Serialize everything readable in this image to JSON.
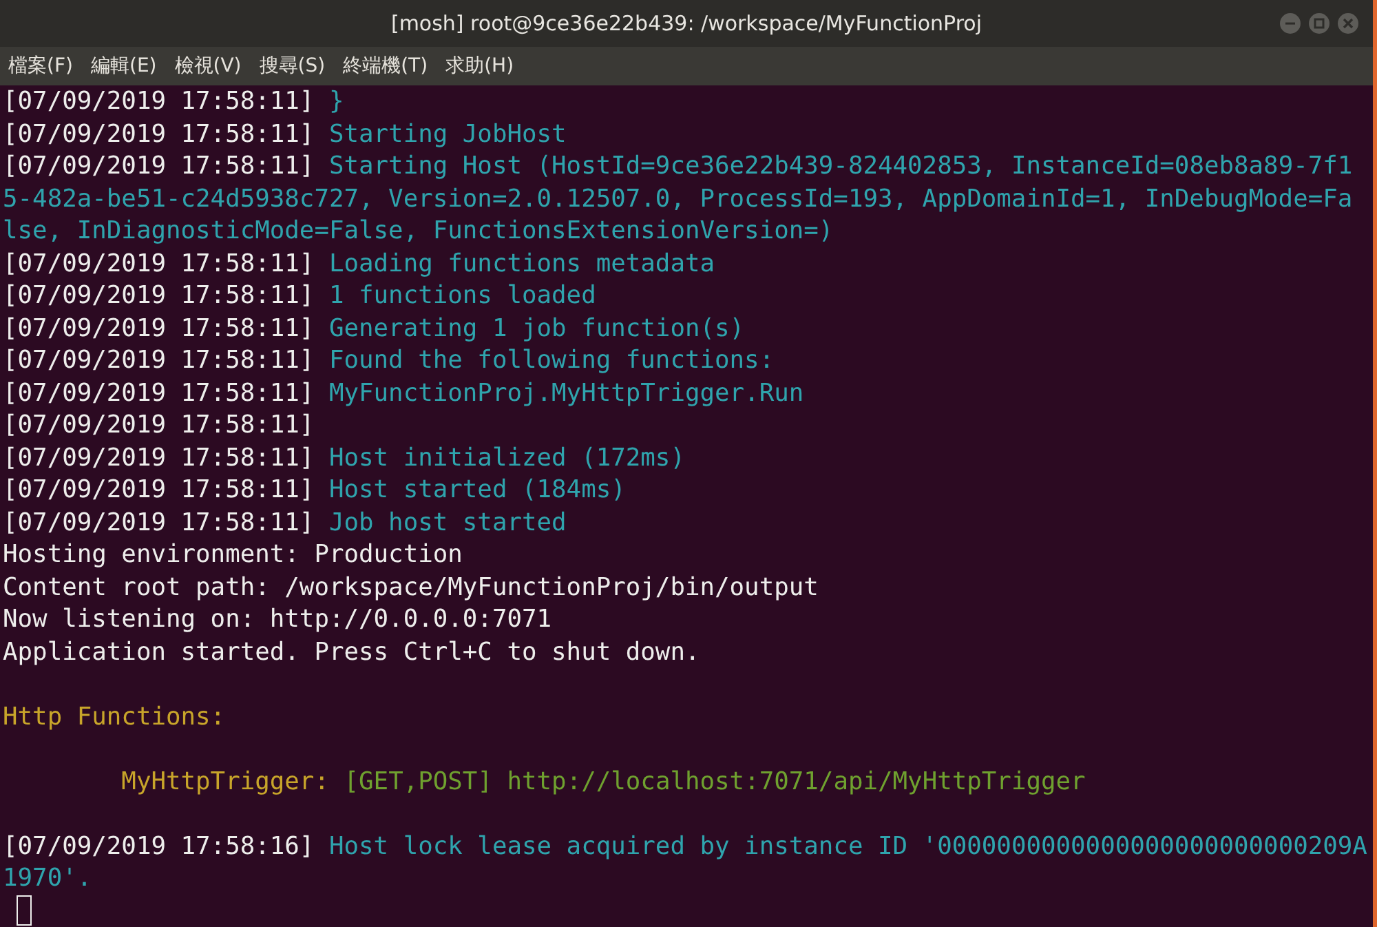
{
  "window": {
    "title": "[mosh] root@9ce36e22b439: /workspace/MyFunctionProj"
  },
  "menu": [
    {
      "label": "檔案(F)"
    },
    {
      "label": "編輯(E)"
    },
    {
      "label": "檢視(V)"
    },
    {
      "label": "搜尋(S)"
    },
    {
      "label": "終端機(T)"
    },
    {
      "label": "求助(H)"
    }
  ],
  "terminal": {
    "lines": [
      {
        "kind": "text",
        "segments": [
          {
            "kind": "plain",
            "text": "[07/09/2019 17:58:11] "
          },
          {
            "kind": "info",
            "text": "}"
          }
        ]
      },
      {
        "kind": "text",
        "segments": [
          {
            "kind": "plain",
            "text": "[07/09/2019 17:58:11] "
          },
          {
            "kind": "info",
            "text": "Starting JobHost"
          }
        ]
      },
      {
        "kind": "text",
        "segments": [
          {
            "kind": "plain",
            "text": "[07/09/2019 17:58:11] "
          },
          {
            "kind": "info",
            "text": "Starting Host (HostId=9ce36e22b439-824402853, InstanceId=08eb8a89-7f1"
          }
        ]
      },
      {
        "kind": "text",
        "segments": [
          {
            "kind": "info",
            "text": "5-482a-be51-c24d5938c727, Version=2.0.12507.0, ProcessId=193, AppDomainId=1, InDebugMode=Fa"
          }
        ]
      },
      {
        "kind": "text",
        "segments": [
          {
            "kind": "info",
            "text": "lse, InDiagnosticMode=False, FunctionsExtensionVersion=)"
          }
        ]
      },
      {
        "kind": "text",
        "segments": [
          {
            "kind": "plain",
            "text": "[07/09/2019 17:58:11] "
          },
          {
            "kind": "info",
            "text": "Loading functions metadata"
          }
        ]
      },
      {
        "kind": "text",
        "segments": [
          {
            "kind": "plain",
            "text": "[07/09/2019 17:58:11] "
          },
          {
            "kind": "info",
            "text": "1 functions loaded"
          }
        ]
      },
      {
        "kind": "text",
        "segments": [
          {
            "kind": "plain",
            "text": "[07/09/2019 17:58:11] "
          },
          {
            "kind": "info",
            "text": "Generating 1 job function(s)"
          }
        ]
      },
      {
        "kind": "text",
        "segments": [
          {
            "kind": "plain",
            "text": "[07/09/2019 17:58:11] "
          },
          {
            "kind": "info",
            "text": "Found the following functions:"
          }
        ]
      },
      {
        "kind": "text",
        "segments": [
          {
            "kind": "plain",
            "text": "[07/09/2019 17:58:11] "
          },
          {
            "kind": "info",
            "text": "MyFunctionProj.MyHttpTrigger.Run"
          }
        ]
      },
      {
        "kind": "text",
        "segments": [
          {
            "kind": "plain",
            "text": "[07/09/2019 17:58:11]"
          }
        ]
      },
      {
        "kind": "text",
        "segments": [
          {
            "kind": "plain",
            "text": "[07/09/2019 17:58:11] "
          },
          {
            "kind": "info",
            "text": "Host initialized (172ms)"
          }
        ]
      },
      {
        "kind": "text",
        "segments": [
          {
            "kind": "plain",
            "text": "[07/09/2019 17:58:11] "
          },
          {
            "kind": "info",
            "text": "Host started (184ms)"
          }
        ]
      },
      {
        "kind": "text",
        "segments": [
          {
            "kind": "plain",
            "text": "[07/09/2019 17:58:11] "
          },
          {
            "kind": "info",
            "text": "Job host started"
          }
        ]
      },
      {
        "kind": "text",
        "segments": [
          {
            "kind": "plain",
            "text": "Hosting environment: Production"
          }
        ]
      },
      {
        "kind": "text",
        "segments": [
          {
            "kind": "plain",
            "text": "Content root path: /workspace/MyFunctionProj/bin/output"
          }
        ]
      },
      {
        "kind": "text",
        "segments": [
          {
            "kind": "plain",
            "text": "Now listening on: http://0.0.0.0:7071"
          }
        ]
      },
      {
        "kind": "text",
        "segments": [
          {
            "kind": "plain",
            "text": "Application started. Press Ctrl+C to shut down."
          }
        ]
      },
      {
        "kind": "blank"
      },
      {
        "kind": "text",
        "segments": [
          {
            "kind": "heading",
            "text": "Http Functions:"
          }
        ]
      },
      {
        "kind": "blank"
      },
      {
        "kind": "text",
        "segments": [
          {
            "kind": "heading",
            "text": "        MyHttpTrigger: "
          },
          {
            "kind": "route",
            "text": "[GET,POST] http://localhost:7071/api/MyHttpTrigger"
          }
        ]
      },
      {
        "kind": "blank"
      },
      {
        "kind": "text",
        "segments": [
          {
            "kind": "plain",
            "text": "[07/09/2019 17:58:16] "
          },
          {
            "kind": "info",
            "text": "Host lock lease acquired by instance ID '0000000000000000000000000209A"
          }
        ]
      },
      {
        "kind": "text",
        "segments": [
          {
            "kind": "info",
            "text": "1970'."
          }
        ]
      },
      {
        "kind": "cursor"
      }
    ]
  }
}
